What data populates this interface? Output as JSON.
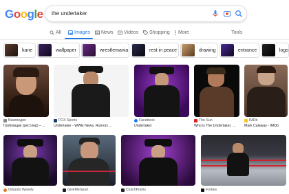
{
  "logo": [
    "G",
    "o",
    "o",
    "g",
    "l",
    "e"
  ],
  "logo_colors": [
    "#4285f4",
    "#ea4335",
    "#fbbc05",
    "#4285f4",
    "#34a853",
    "#ea4335"
  ],
  "search": {
    "query": "the undertaker"
  },
  "tabs": {
    "all": "All",
    "images": "Images",
    "news": "News",
    "videos": "Videos",
    "shopping": "Shopping",
    "more": "More",
    "tools": "Tools"
  },
  "chips": [
    "kane",
    "wallpaper",
    "wrestlemania",
    "rest in peace",
    "drawing",
    "entrance",
    "logo"
  ],
  "results": [
    {
      "source": "Википедия",
      "title": "Гробовщик (рестлер) – ..."
    },
    {
      "source": "FOX Sports",
      "title": "Undertaker - WWE News, Rumors ..."
    },
    {
      "source": "Facebook",
      "title": "Undertaker"
    },
    {
      "source": "The Sun",
      "title": "Who is The Undertaker, ..."
    },
    {
      "source": "IMDb",
      "title": "Mark Calaway - IMDb"
    },
    {
      "source": "Orlando Weekly",
      "title": ""
    },
    {
      "source": "GiveMeSport",
      "title": ""
    },
    {
      "source": "ClutchPoints",
      "title": ""
    },
    {
      "source": "Forbes",
      "title": ""
    }
  ],
  "accent": "#1a73e8"
}
